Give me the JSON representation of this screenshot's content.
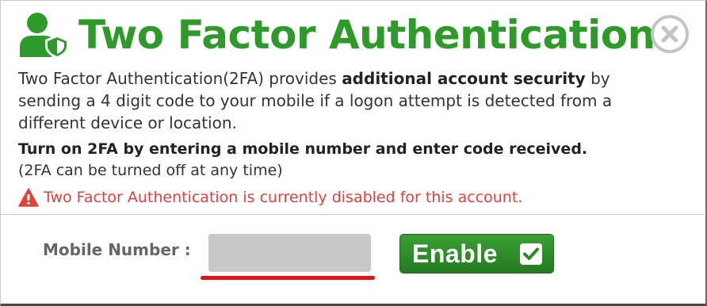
{
  "dialog": {
    "title": "Two Factor Authentication",
    "description_pre": "Two Factor Authentication(2FA) provides ",
    "description_bold": "additional account security",
    "description_post": " by sending a 4 digit code to your mobile if a logon attempt is detected from a different device or location.",
    "instruction": "Turn on 2FA by entering a mobile number and enter code received.",
    "note": "(2FA can be turned off at any time)",
    "warning": "Two Factor Authentication is currently disabled for this account."
  },
  "form": {
    "mobile_label": "Mobile Number :",
    "mobile_value": "",
    "enable_label": "Enable"
  },
  "icons": {
    "header": "user-shield-icon",
    "close": "close-circle-icon",
    "warning": "warning-triangle-icon",
    "enable": "checkbox-check-icon"
  },
  "colors": {
    "title_green": "#2e9a2a",
    "warning_red": "#e2413b",
    "button_green": "#2c8a27",
    "underline_red": "#e0131b",
    "input_gray": "#c8c8c8"
  }
}
